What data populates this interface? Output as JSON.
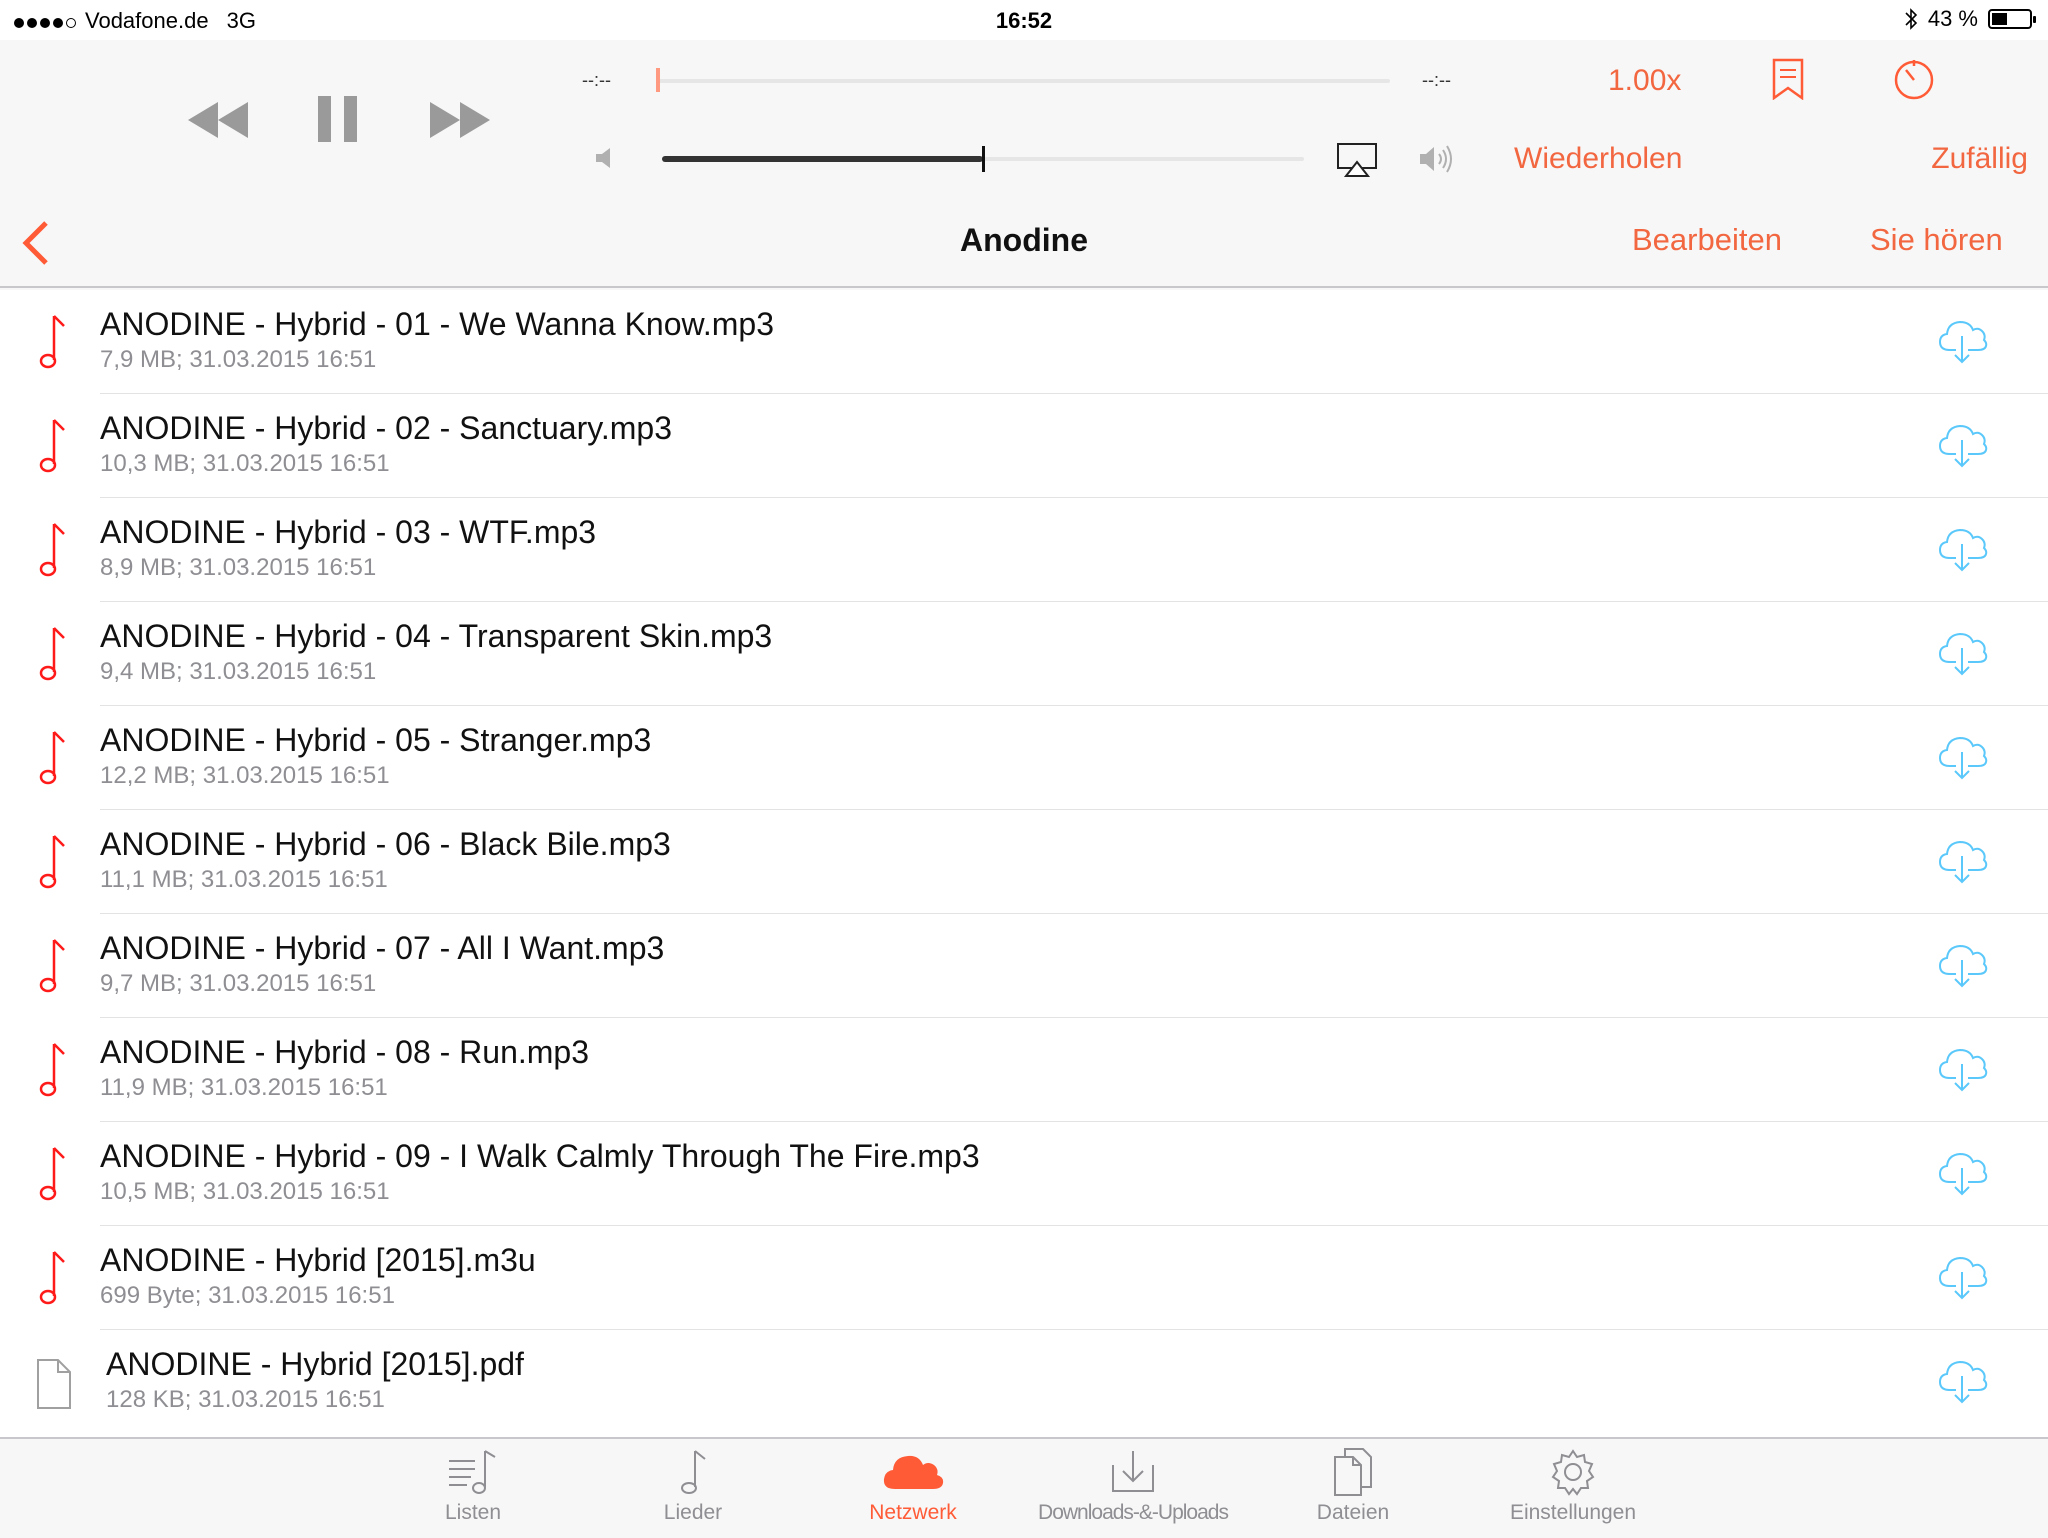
{
  "status": {
    "carrier": "Vodafone.de",
    "network": "3G",
    "time": "16:52",
    "battery": "43 %",
    "battery_level": 0.43
  },
  "player": {
    "elapsed": "--:--",
    "remaining": "--:--",
    "speed": "1.00x",
    "repeat_label": "Wiederholen",
    "shuffle_label": "Zufällig",
    "volume_level": 0.5,
    "progress_level": 0.0
  },
  "nav": {
    "title": "Anodine",
    "edit_label": "Bearbeiten",
    "listen_label": "Sie hören"
  },
  "files": [
    {
      "name": "ANODINE - Hybrid - 01 - We Wanna Know.mp3",
      "meta": "7,9 MB; 31.03.2015 16:51",
      "type": "audio"
    },
    {
      "name": "ANODINE - Hybrid - 02 - Sanctuary.mp3",
      "meta": "10,3 MB; 31.03.2015 16:51",
      "type": "audio"
    },
    {
      "name": "ANODINE - Hybrid - 03 - WTF.mp3",
      "meta": "8,9 MB; 31.03.2015 16:51",
      "type": "audio"
    },
    {
      "name": "ANODINE - Hybrid - 04 - Transparent Skin.mp3",
      "meta": "9,4 MB; 31.03.2015 16:51",
      "type": "audio"
    },
    {
      "name": "ANODINE - Hybrid - 05 - Stranger.mp3",
      "meta": "12,2 MB; 31.03.2015 16:51",
      "type": "audio"
    },
    {
      "name": "ANODINE - Hybrid - 06 - Black Bile.mp3",
      "meta": "11,1 MB; 31.03.2015 16:51",
      "type": "audio"
    },
    {
      "name": "ANODINE - Hybrid - 07 - All I Want.mp3",
      "meta": "9,7 MB; 31.03.2015 16:51",
      "type": "audio"
    },
    {
      "name": "ANODINE - Hybrid - 08 - Run.mp3",
      "meta": "11,9 MB; 31.03.2015 16:51",
      "type": "audio"
    },
    {
      "name": "ANODINE - Hybrid - 09 - I Walk Calmly Through The Fire.mp3",
      "meta": "10,5 MB; 31.03.2015 16:51",
      "type": "audio"
    },
    {
      "name": "ANODINE - Hybrid [2015].m3u",
      "meta": "699 Byte; 31.03.2015 16:51",
      "type": "audio"
    },
    {
      "name": "ANODINE - Hybrid [2015].pdf",
      "meta": "128 KB; 31.03.2015 16:51",
      "type": "document"
    }
  ],
  "tabs": [
    {
      "label": "Listen",
      "icon": "list-music-icon"
    },
    {
      "label": "Lieder",
      "icon": "music-note-icon"
    },
    {
      "label": "Netzwerk",
      "icon": "cloud-icon",
      "active": true
    },
    {
      "label": "Downloads-&-Uploads",
      "icon": "download-tray-icon"
    },
    {
      "label": "Dateien",
      "icon": "documents-icon"
    },
    {
      "label": "Einstellungen",
      "icon": "gear-icon"
    }
  ],
  "colors": {
    "accent": "#f26640",
    "cloud": "#5ac8fa",
    "note": "#ff1a1a"
  }
}
